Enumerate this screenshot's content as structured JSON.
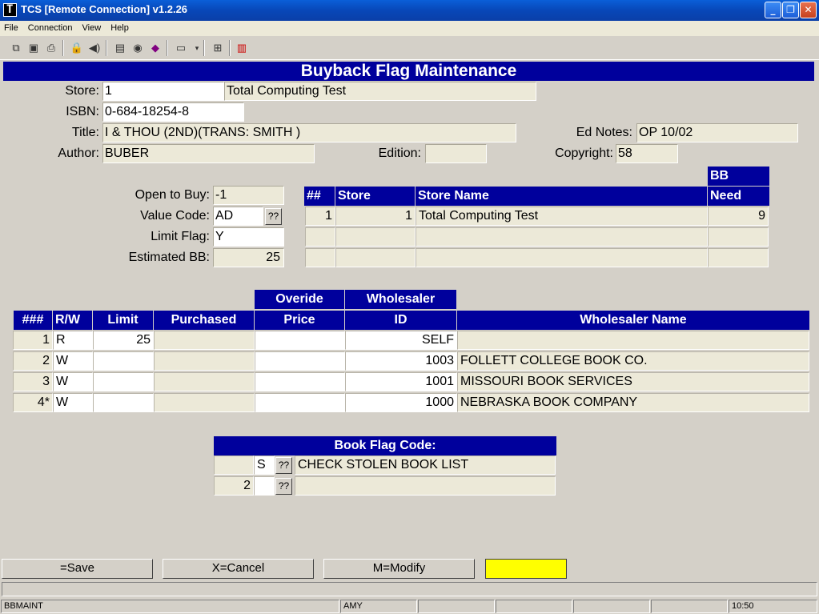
{
  "window": {
    "title": "TCS [Remote Connection]  v1.2.26"
  },
  "menu": [
    "File",
    "Connection",
    "View",
    "Help"
  ],
  "page_title": "Buyback Flag Maintenance",
  "form": {
    "store_label": "Store:",
    "store_value": "1",
    "store_name": "Total Computing Test",
    "isbn_label": "ISBN:",
    "isbn_value": "0-684-18254-8",
    "title_label": "Title:",
    "title_value": "I & THOU (2ND)(TRANS: SMITH )",
    "ednotes_label": "Ed Notes:",
    "ednotes_value": "OP 10/02",
    "author_label": "Author:",
    "author_value": "BUBER",
    "edition_label": "Edition:",
    "edition_value": "",
    "copyright_label": "Copyright:",
    "copyright_value": "58",
    "open_to_buy_label": "Open to Buy:",
    "open_to_buy_value": "-1",
    "value_code_label": "Value Code:",
    "value_code_value": "AD",
    "limit_flag_label": "Limit Flag:",
    "limit_flag_value": "Y",
    "est_bb_label": "Estimated BB:",
    "est_bb_value": "25",
    "lookup_label": "??"
  },
  "store_table": {
    "headers": {
      "num": "##",
      "store": "Store",
      "store_name": "Store Name",
      "bb_top": "BB",
      "bb_need": "Need"
    },
    "rows": [
      {
        "num": "1",
        "store": "1",
        "store_name": "Total Computing Test",
        "need": "9"
      },
      {
        "num": "",
        "store": "",
        "store_name": "",
        "need": ""
      },
      {
        "num": "",
        "store": "",
        "store_name": "",
        "need": ""
      }
    ]
  },
  "wholesaler_table": {
    "headers": {
      "num": "###",
      "rw": "R/W",
      "limit": "Limit",
      "purchased": "Purchased",
      "override_top": "Overide",
      "price": "Price",
      "wholesaler_top": "Wholesaler",
      "id": "ID",
      "name": "Wholesaler Name"
    },
    "rows": [
      {
        "num": "1",
        "rw": "R",
        "limit": "25",
        "purchased": "",
        "price": "",
        "id": "SELF",
        "name": ""
      },
      {
        "num": "2",
        "rw": "W",
        "limit": "",
        "purchased": "",
        "price": "",
        "id": "1003",
        "name": "FOLLETT COLLEGE BOOK CO."
      },
      {
        "num": "3",
        "rw": "W",
        "limit": "",
        "purchased": "",
        "price": "",
        "id": "1001",
        "name": "MISSOURI BOOK SERVICES"
      },
      {
        "num": "4*",
        "rw": "W",
        "limit": "",
        "purchased": "",
        "price": "",
        "id": "1000",
        "name": "NEBRASKA BOOK COMPANY"
      }
    ]
  },
  "book_flag": {
    "header": "Book Flag Code:",
    "rows": [
      {
        "num": "",
        "code": "S",
        "desc": "CHECK STOLEN BOOK LIST"
      },
      {
        "num": "2",
        "code": "",
        "desc": ""
      }
    ]
  },
  "buttons": {
    "save": "=Save",
    "cancel": "X=Cancel",
    "modify": "M=Modify"
  },
  "status": {
    "program": "BBMAINT",
    "user": "AMY",
    "time": "10:50"
  },
  "colors": {
    "header_blue": "#00009c",
    "indicator": "#ffff00"
  }
}
